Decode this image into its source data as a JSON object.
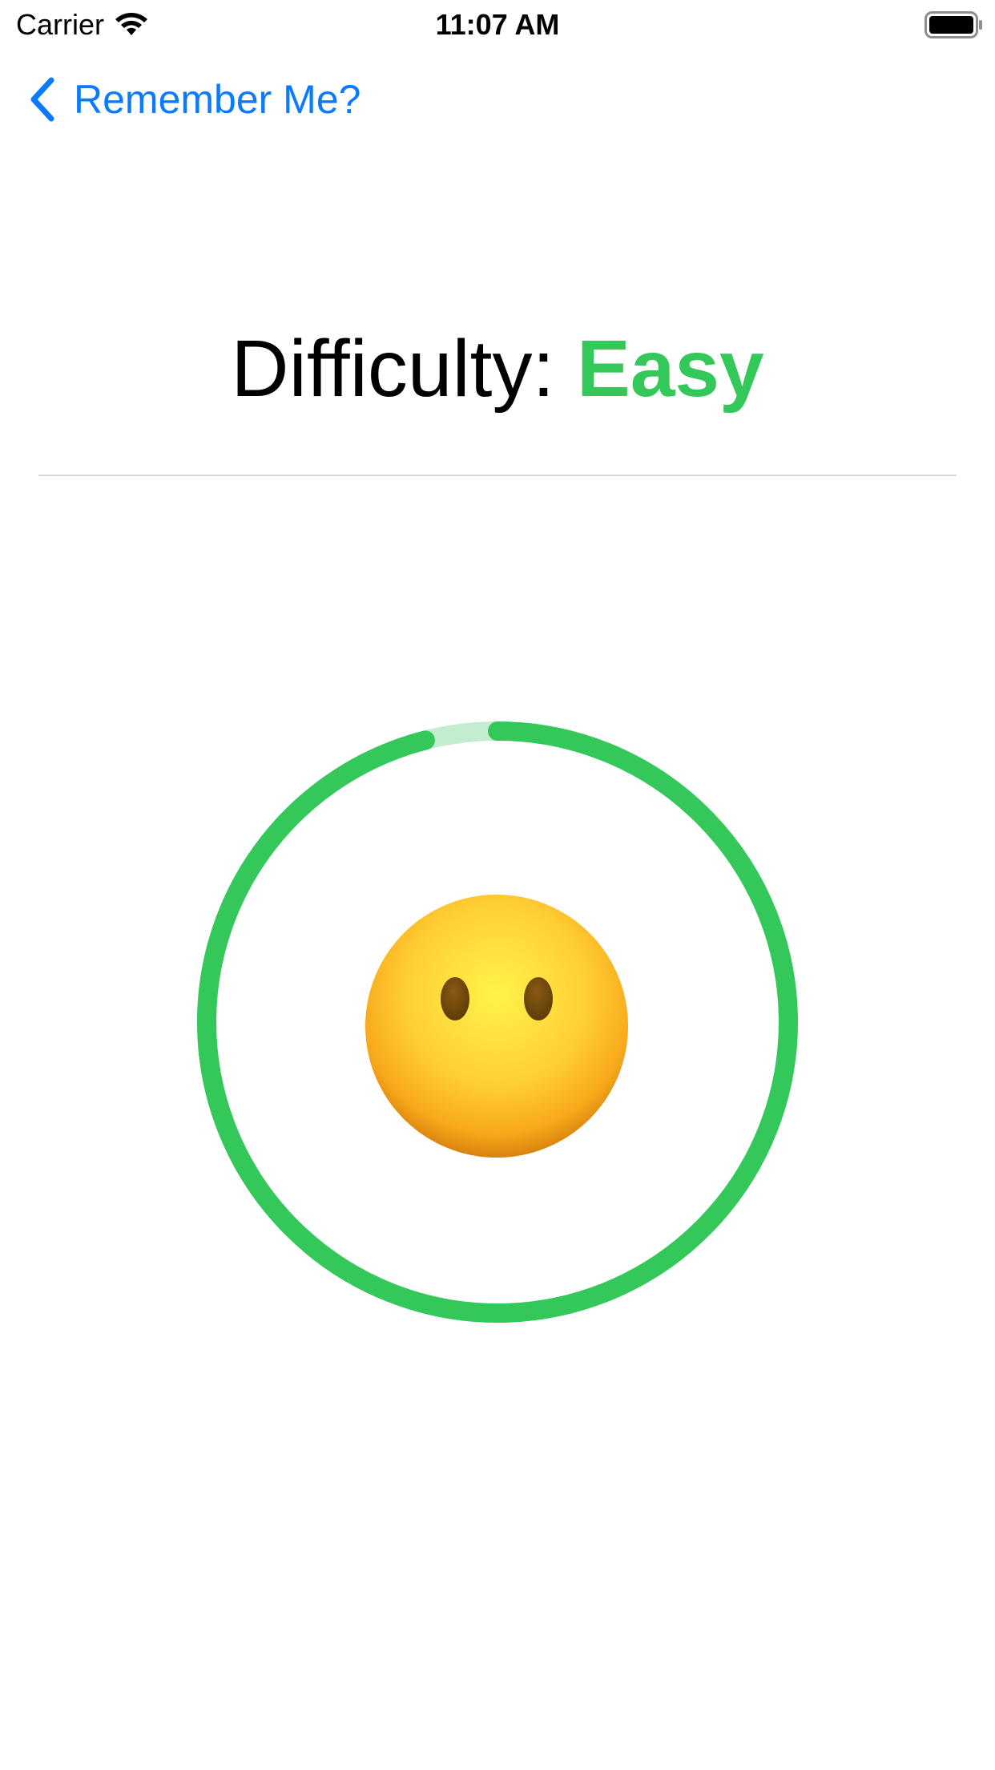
{
  "status_bar": {
    "carrier": "Carrier",
    "time": "11:07 AM",
    "icons": [
      "wifi-icon",
      "battery-icon"
    ]
  },
  "nav": {
    "back_label": "Remember Me?",
    "back_icon": "chevron-left-icon"
  },
  "difficulty": {
    "label": "Difficulty:",
    "value": "Easy"
  },
  "timer": {
    "progress": 0.96
  },
  "face_icon": "face-without-mouth-icon",
  "colors": {
    "accent": "#0a7aff",
    "green": "#34c759",
    "green_track": "#c4ecce",
    "divider": "#d9d9d9"
  }
}
